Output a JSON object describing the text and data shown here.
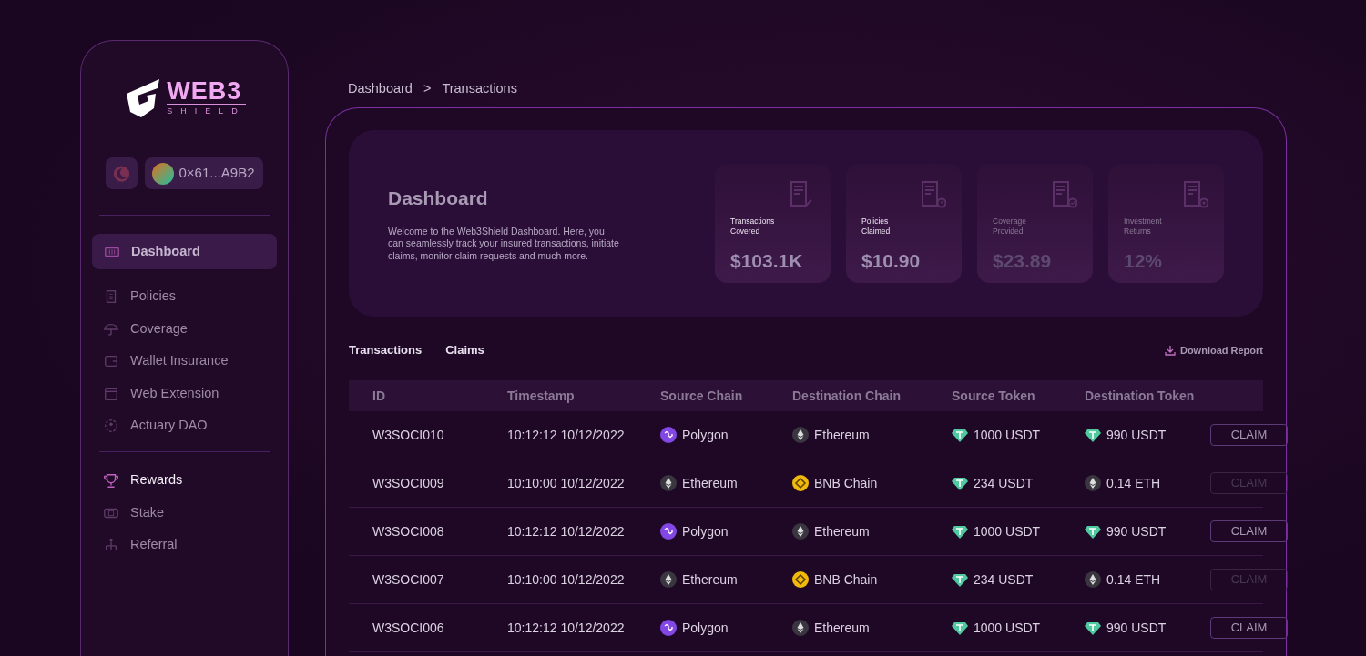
{
  "logo": {
    "word": "WEB3",
    "subword": "SHIELD"
  },
  "wallet": {
    "address": "0×61...A9B2"
  },
  "sidebar": {
    "groups": [
      {
        "items": [
          {
            "label": "Dashboard",
            "kind": "dashboard",
            "selected": true,
            "highlighted": false
          },
          {
            "label": "Policies",
            "kind": "policies",
            "selected": false,
            "highlighted": false
          },
          {
            "label": "Coverage",
            "kind": "coverage",
            "selected": false,
            "highlighted": false
          },
          {
            "label": "Wallet Insurance",
            "kind": "wallet",
            "selected": false,
            "highlighted": false
          },
          {
            "label": "Web Extension",
            "kind": "extension",
            "selected": false,
            "highlighted": false
          },
          {
            "label": "Actuary DAO",
            "kind": "dao",
            "selected": false,
            "highlighted": false
          }
        ]
      },
      {
        "items": [
          {
            "label": "Rewards",
            "kind": "rewards",
            "selected": false,
            "highlighted": true
          },
          {
            "label": "Stake",
            "kind": "stake",
            "selected": false,
            "highlighted": false
          },
          {
            "label": "Referral",
            "kind": "referral",
            "selected": false,
            "highlighted": false
          }
        ]
      }
    ]
  },
  "breadcrumb": [
    "Dashboard",
    ">",
    "Transactions"
  ],
  "hero": {
    "title": "Dashboard",
    "text": "Welcome to the Web3Shield Dashboard. Here, you can seamlessly track your insured transactions, initiate claims, monitor claim requests and much more.",
    "stats": [
      {
        "label": "Transactions Covered",
        "value": "$103.1K",
        "kind": "doc",
        "dimmed": false
      },
      {
        "label": "Policies Claimed",
        "value": "$10.90",
        "kind": "clock",
        "dimmed": false
      },
      {
        "label": "Coverage Provided",
        "value": "$23.89",
        "kind": "check",
        "dimmed": true
      },
      {
        "label": "Investment Returns",
        "value": "12%",
        "kind": "plus",
        "dimmed": true
      }
    ]
  },
  "tabs": [
    "Transactions",
    "Claims"
  ],
  "download": "Download Report",
  "table": {
    "columns": [
      "ID",
      "Timestamp",
      "Source Chain",
      "Destination Chain",
      "Source Token",
      "Destination Token"
    ],
    "rows": [
      {
        "id": "W3SOCI010",
        "timestamp": "10:12:12 10/12/2022",
        "source_chain": {
          "name": "Polygon",
          "kind": "polygon"
        },
        "destination_chain": {
          "name": "Ethereum",
          "kind": "ethereum"
        },
        "source_token": {
          "amount": "1000 USDT",
          "kind": "usdt"
        },
        "destination_token": {
          "amount": "990 USDT",
          "kind": "usdt"
        },
        "action": {
          "label": "CLAIM",
          "disabled": false
        }
      },
      {
        "id": "W3SOCI009",
        "timestamp": "10:10:00 10/12/2022",
        "source_chain": {
          "name": "Ethereum",
          "kind": "ethereum"
        },
        "destination_chain": {
          "name": "BNB Chain",
          "kind": "bnb"
        },
        "source_token": {
          "amount": "234 USDT",
          "kind": "usdt"
        },
        "destination_token": {
          "amount": "0.14 ETH",
          "kind": "ethereum"
        },
        "action": {
          "label": "CLAIM",
          "disabled": true
        }
      },
      {
        "id": "W3SOCI008",
        "timestamp": "10:12:12 10/12/2022",
        "source_chain": {
          "name": "Polygon",
          "kind": "polygon"
        },
        "destination_chain": {
          "name": "Ethereum",
          "kind": "ethereum"
        },
        "source_token": {
          "amount": "1000 USDT",
          "kind": "usdt"
        },
        "destination_token": {
          "amount": "990 USDT",
          "kind": "usdt"
        },
        "action": {
          "label": "CLAIM",
          "disabled": false
        }
      },
      {
        "id": "W3SOCI007",
        "timestamp": "10:10:00 10/12/2022",
        "source_chain": {
          "name": "Ethereum",
          "kind": "ethereum"
        },
        "destination_chain": {
          "name": "BNB Chain",
          "kind": "bnb"
        },
        "source_token": {
          "amount": "234 USDT",
          "kind": "usdt"
        },
        "destination_token": {
          "amount": "0.14 ETH",
          "kind": "ethereum"
        },
        "action": {
          "label": "CLAIM",
          "disabled": true
        }
      },
      {
        "id": "W3SOCI006",
        "timestamp": "10:12:12 10/12/2022",
        "source_chain": {
          "name": "Polygon",
          "kind": "polygon"
        },
        "destination_chain": {
          "name": "Ethereum",
          "kind": "ethereum"
        },
        "source_token": {
          "amount": "1000 USDT",
          "kind": "usdt"
        },
        "destination_token": {
          "amount": "990 USDT",
          "kind": "usdt"
        },
        "action": {
          "label": "CLAIM",
          "disabled": false
        }
      }
    ]
  }
}
